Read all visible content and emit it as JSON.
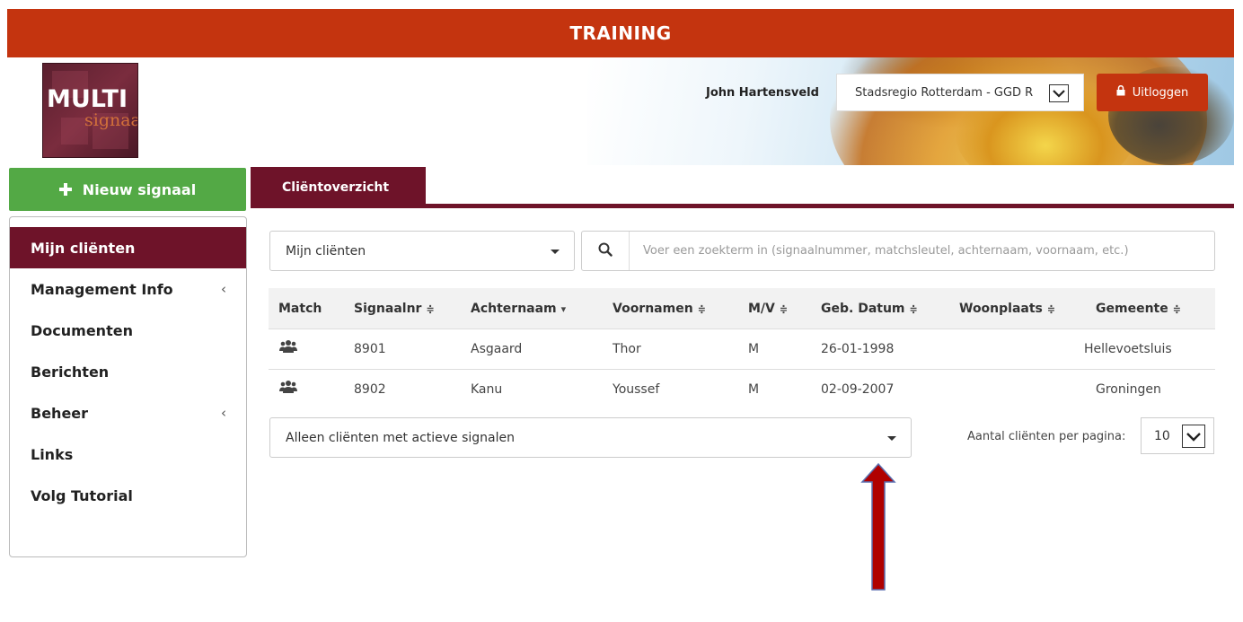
{
  "banner": {
    "title": "TRAINING"
  },
  "logo": {
    "line1": "MULTI",
    "line2": "signaal"
  },
  "header": {
    "user_name": "John Hartensveld",
    "organisation": "Stadsregio Rotterdam - GGD R",
    "logout_label": "Uitloggen",
    "logout_icon": "lock-icon"
  },
  "sidebar": {
    "new_button_label": "Nieuw signaal",
    "items": [
      {
        "label": "Mijn cliënten",
        "active": true,
        "chevron": ""
      },
      {
        "label": "Management Info",
        "active": false,
        "chevron": "‹"
      },
      {
        "label": "Documenten",
        "active": false,
        "chevron": ""
      },
      {
        "label": "Berichten",
        "active": false,
        "chevron": ""
      },
      {
        "label": "Beheer",
        "active": false,
        "chevron": "‹"
      },
      {
        "label": "Links",
        "active": false,
        "chevron": ""
      },
      {
        "label": "Volg Tutorial",
        "active": false,
        "chevron": ""
      }
    ]
  },
  "tabs": [
    {
      "label": "Cliëntoverzicht",
      "active": true
    }
  ],
  "filters": {
    "client_scope": "Mijn cliënten",
    "search_placeholder": "Voer een zoekterm in (signaalnummer, matchsleutel, achternaam, voornaam, etc.)",
    "signal_filter": "Alleen cliënten met actieve signalen",
    "per_page_label": "Aantal cliënten per pagina:",
    "per_page_value": "10"
  },
  "table": {
    "columns": [
      {
        "label": "Match",
        "sort": ""
      },
      {
        "label": "Signaalnr",
        "sort": "≑"
      },
      {
        "label": "Achternaam",
        "sort": "▾"
      },
      {
        "label": "Voornamen",
        "sort": "≑"
      },
      {
        "label": "M/V",
        "sort": "≑"
      },
      {
        "label": "Geb. Datum",
        "sort": "≑"
      },
      {
        "label": "Woonplaats",
        "sort": "≑"
      },
      {
        "label": "Gemeente",
        "sort": "≑"
      }
    ],
    "rows": [
      {
        "match_icon": "users-icon",
        "signaalnr": "8901",
        "achternaam": "Asgaard",
        "voornamen": "Thor",
        "mv": "M",
        "geb_datum": "26-01-1998",
        "woonplaats": "",
        "gemeente": "Hellevoetsluis"
      },
      {
        "match_icon": "users-icon",
        "signaalnr": "8902",
        "achternaam": "Kanu",
        "voornamen": "Youssef",
        "mv": "M",
        "geb_datum": "02-09-2007",
        "woonplaats": "",
        "gemeente": "Groningen"
      }
    ]
  },
  "colors": {
    "banner": "#c4340f",
    "primary": "#6e1329",
    "new_button": "#53a945",
    "arrow": "#b00000"
  }
}
